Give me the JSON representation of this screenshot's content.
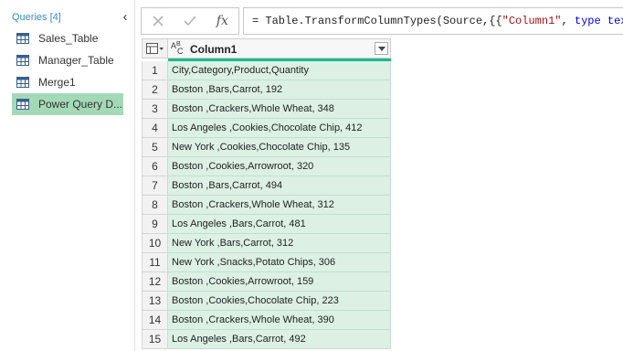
{
  "queries": {
    "header": "Queries [4]",
    "items": [
      {
        "label": "Sales_Table",
        "selected": false,
        "icon": "table-icon"
      },
      {
        "label": "Manager_Table",
        "selected": false,
        "icon": "table-icon"
      },
      {
        "label": "Merge1",
        "selected": false,
        "icon": "table-icon"
      },
      {
        "label": "Power Query D...",
        "selected": true,
        "icon": "table-icon"
      }
    ]
  },
  "formula": {
    "cancel_icon": "close-icon",
    "commit_icon": "check-icon",
    "fx_label": "fx",
    "parts": {
      "p1": "= Table.TransformColumnTypes(Source,{{",
      "p2": "\"Column1\"",
      "p3": ", ",
      "p4": "type text",
      "p5": "}})"
    }
  },
  "grid": {
    "column_header": "Column1",
    "column_type_icon": "text-type-icon",
    "quality_bar_color": "#1eb88e",
    "cell_color": "#dcf1e4",
    "rows": [
      {
        "num": "1",
        "value": "City,Category,Product,Quantity"
      },
      {
        "num": "2",
        "value": "Boston ,Bars,Carrot, 192"
      },
      {
        "num": "3",
        "value": "Boston ,Crackers,Whole Wheat, 348"
      },
      {
        "num": "4",
        "value": "Los Angeles ,Cookies,Chocolate Chip, 412"
      },
      {
        "num": "5",
        "value": "New York ,Cookies,Chocolate Chip, 135"
      },
      {
        "num": "6",
        "value": "Boston ,Cookies,Arrowroot, 320"
      },
      {
        "num": "7",
        "value": "Boston ,Bars,Carrot, 494"
      },
      {
        "num": "8",
        "value": "Boston ,Crackers,Whole Wheat, 312"
      },
      {
        "num": "9",
        "value": "Los Angeles ,Bars,Carrot, 481"
      },
      {
        "num": "10",
        "value": "New York ,Bars,Carrot, 312"
      },
      {
        "num": "11",
        "value": "New York ,Snacks,Potato Chips, 306"
      },
      {
        "num": "12",
        "value": "Boston ,Cookies,Arrowroot, 159"
      },
      {
        "num": "13",
        "value": "Boston ,Cookies,Chocolate Chip, 223"
      },
      {
        "num": "14",
        "value": "Boston ,Crackers,Whole Wheat, 390"
      },
      {
        "num": "15",
        "value": "Los Angeles ,Bars,Carrot, 492"
      }
    ]
  }
}
